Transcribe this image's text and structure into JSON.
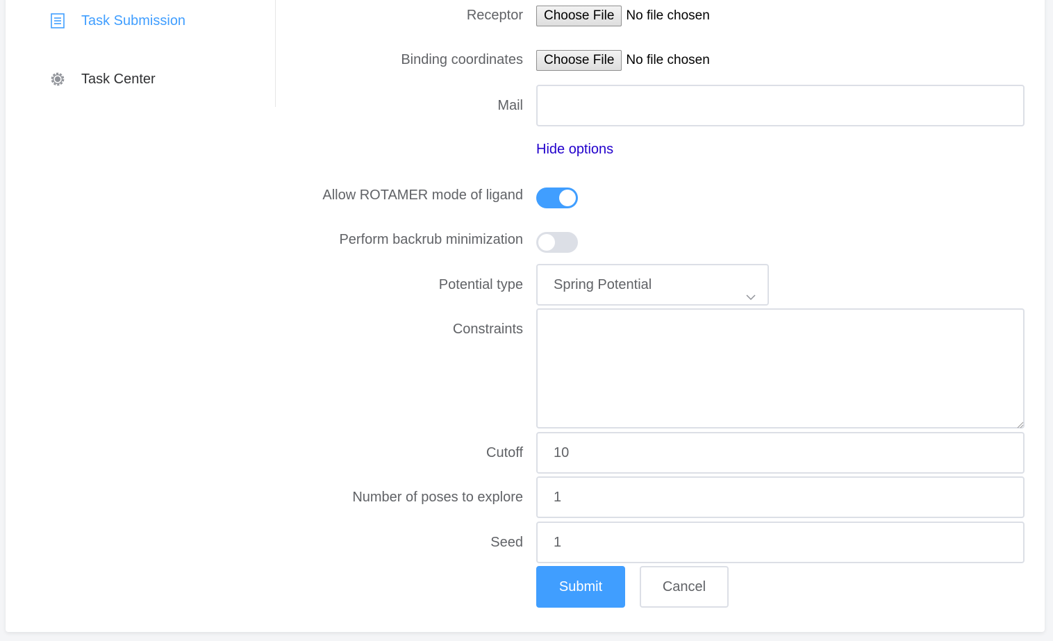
{
  "sidebar": {
    "items": [
      {
        "label": "Task Submission",
        "icon": "document-icon",
        "active": true
      },
      {
        "label": "Task Center",
        "icon": "gear-icon",
        "active": false
      }
    ]
  },
  "form": {
    "receptor": {
      "label": "Receptor",
      "button": "Choose File",
      "status": "No file chosen"
    },
    "binding": {
      "label": "Binding coordinates",
      "button": "Choose File",
      "status": "No file chosen"
    },
    "mail": {
      "label": "Mail",
      "value": ""
    },
    "options_link": "Hide options",
    "rotamer": {
      "label": "Allow ROTAMER mode of ligand",
      "on": true
    },
    "backrub": {
      "label": "Perform backrub minimization",
      "on": false
    },
    "potential": {
      "label": "Potential type",
      "value": "Spring Potential"
    },
    "constraints": {
      "label": "Constraints",
      "value": ""
    },
    "cutoff": {
      "label": "Cutoff",
      "value": "10"
    },
    "poses": {
      "label": "Number of poses to explore",
      "value": "1"
    },
    "seed": {
      "label": "Seed",
      "value": "1"
    },
    "submit": "Submit",
    "cancel": "Cancel"
  },
  "colors": {
    "accent": "#409eff",
    "link": "#2200cc",
    "border": "#dcdfe6",
    "text": "#606266"
  }
}
